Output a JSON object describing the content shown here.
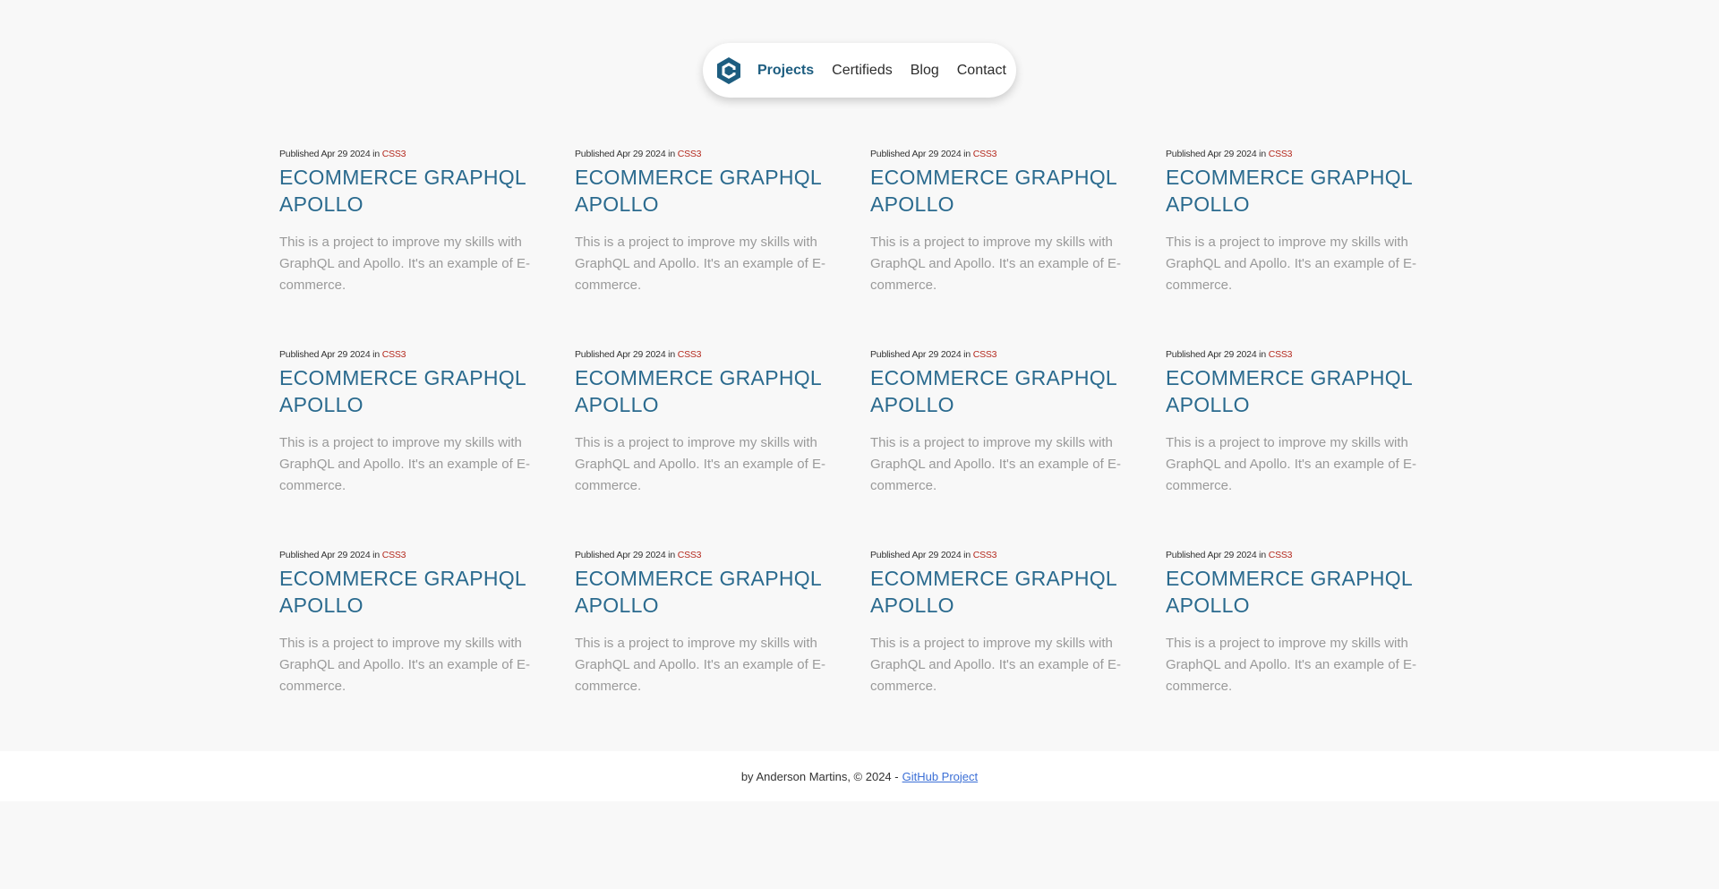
{
  "nav": {
    "logo_icon": "hexagon-logo-icon",
    "items": [
      {
        "label": "Projects",
        "active": true
      },
      {
        "label": "Certifieds",
        "active": false
      },
      {
        "label": "Blog",
        "active": false
      },
      {
        "label": "Contact",
        "active": false
      }
    ]
  },
  "projects": [
    {
      "published": "Published Apr 29 2024 in",
      "tag": "CSS3",
      "title": "ECOMMERCE GRAPHQL APOLLO",
      "description": "This is a project to improve my skills with GraphQL and Apollo. It's an example of E-commerce."
    },
    {
      "published": "Published Apr 29 2024 in",
      "tag": "CSS3",
      "title": "ECOMMERCE GRAPHQL APOLLO",
      "description": "This is a project to improve my skills with GraphQL and Apollo. It's an example of E-commerce."
    },
    {
      "published": "Published Apr 29 2024 in",
      "tag": "CSS3",
      "title": "ECOMMERCE GRAPHQL APOLLO",
      "description": "This is a project to improve my skills with GraphQL and Apollo. It's an example of E-commerce."
    },
    {
      "published": "Published Apr 29 2024 in",
      "tag": "CSS3",
      "title": "ECOMMERCE GRAPHQL APOLLO",
      "description": "This is a project to improve my skills with GraphQL and Apollo. It's an example of E-commerce."
    },
    {
      "published": "Published Apr 29 2024 in",
      "tag": "CSS3",
      "title": "ECOMMERCE GRAPHQL APOLLO",
      "description": "This is a project to improve my skills with GraphQL and Apollo. It's an example of E-commerce."
    },
    {
      "published": "Published Apr 29 2024 in",
      "tag": "CSS3",
      "title": "ECOMMERCE GRAPHQL APOLLO",
      "description": "This is a project to improve my skills with GraphQL and Apollo. It's an example of E-commerce."
    },
    {
      "published": "Published Apr 29 2024 in",
      "tag": "CSS3",
      "title": "ECOMMERCE GRAPHQL APOLLO",
      "description": "This is a project to improve my skills with GraphQL and Apollo. It's an example of E-commerce."
    },
    {
      "published": "Published Apr 29 2024 in",
      "tag": "CSS3",
      "title": "ECOMMERCE GRAPHQL APOLLO",
      "description": "This is a project to improve my skills with GraphQL and Apollo. It's an example of E-commerce."
    },
    {
      "published": "Published Apr 29 2024 in",
      "tag": "CSS3",
      "title": "ECOMMERCE GRAPHQL APOLLO",
      "description": "This is a project to improve my skills with GraphQL and Apollo. It's an example of E-commerce."
    },
    {
      "published": "Published Apr 29 2024 in",
      "tag": "CSS3",
      "title": "ECOMMERCE GRAPHQL APOLLO",
      "description": "This is a project to improve my skills with GraphQL and Apollo. It's an example of E-commerce."
    },
    {
      "published": "Published Apr 29 2024 in",
      "tag": "CSS3",
      "title": "ECOMMERCE GRAPHQL APOLLO",
      "description": "This is a project to improve my skills with GraphQL and Apollo. It's an example of E-commerce."
    },
    {
      "published": "Published Apr 29 2024 in",
      "tag": "CSS3",
      "title": "ECOMMERCE GRAPHQL APOLLO",
      "description": "This is a project to improve my skills with GraphQL and Apollo. It's an example of E-commerce."
    }
  ],
  "footer": {
    "text": "by Anderson Martins, © 2024 -",
    "link_label": "GitHub Project"
  },
  "colors": {
    "accent": "#1d5d80",
    "title": "#2a6a8e",
    "tag": "#b42a1f",
    "link": "#3b6fd6",
    "background": "#f8f8f8"
  }
}
